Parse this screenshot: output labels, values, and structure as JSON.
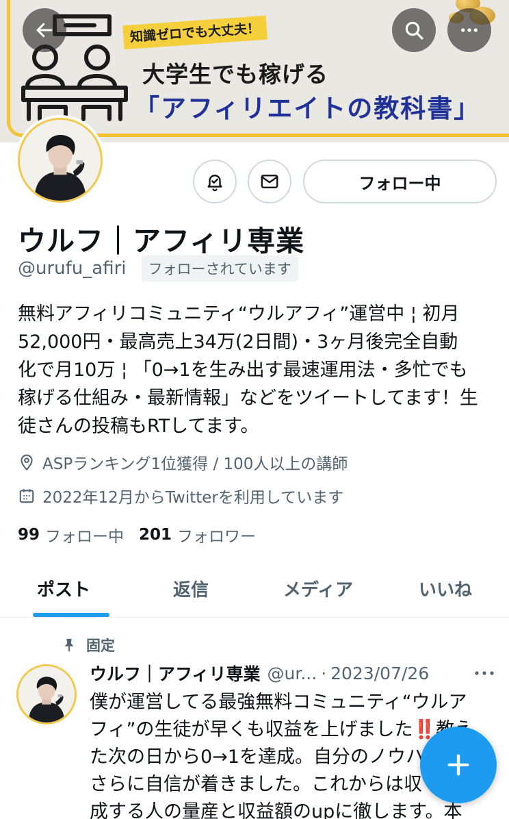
{
  "banner": {
    "tag": "知識ゼロでも大丈夫！",
    "line1": "大学生でも稼げる",
    "line2": "「アフィリエイトの教科書」"
  },
  "top_bar": {
    "back_icon": "arrow-left-icon",
    "search_icon": "search-icon",
    "more_icon": "more-horizontal-icon"
  },
  "actions": {
    "notify_icon": "bell-check-icon",
    "message_icon": "envelope-icon",
    "follow_label": "フォロー中"
  },
  "profile": {
    "name": "ウルフ｜アフィリ専業",
    "handle": "@urufu_afiri",
    "follows_you": "フォローされています",
    "bio": "無料アフィリコミュニティ“ウルアフィ”運営中 ¦ 初月\n52,000円・最高売上34万(2日間)・3ヶ月後完全自動\n化で月10万 ¦ 「0→1を生み出す最速運用法・多忙でも\n稼げる仕組み・最新情報」などをツイートしてます！生\n徒さんの投稿もRTしてます。",
    "location": "ASPランキング1位獲得 / 100人以上の講師",
    "joined": "2022年12月からTwitterを利用しています",
    "following_count": "99",
    "following_label": "フォロー中",
    "followers_count": "201",
    "followers_label": "フォロワー"
  },
  "tabs": [
    {
      "label": "ポスト",
      "active": true
    },
    {
      "label": "返信",
      "active": false
    },
    {
      "label": "メディア",
      "active": false
    },
    {
      "label": "いいね",
      "active": false
    }
  ],
  "pinned_post": {
    "pinned_label": "固定",
    "author": "ウルフ｜アフィリ専業",
    "handle": "@ur...",
    "separator": "·",
    "date": "2023/07/26",
    "text_line1": "僕が運営してる最強無料コミュニティ“ウルア",
    "text_line2_before": "フィ”の生徒が早くも収益を上げました",
    "text_line2_emoji": "‼️",
    "text_line2_after": "教え",
    "text_rest": "た次の日から0→1を達成。自分のノウハ\nさらに自信が着きました。これからは収\n成する人の量産と収益額のupに徹します。本"
  },
  "fab": {
    "icon": "plus-icon"
  },
  "colors": {
    "accent": "#1d9bf0",
    "banner_gold": "#f3c235",
    "banner_title_blue": "#20329a",
    "secondary_text": "#536471"
  }
}
